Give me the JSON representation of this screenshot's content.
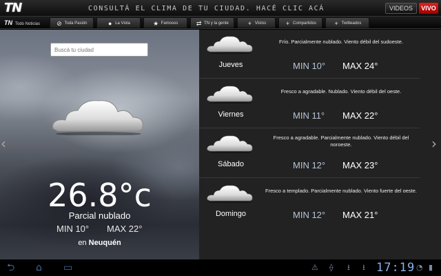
{
  "header": {
    "logo": "TN",
    "promo": "CONSULTÁ EL CLIMA DE TU CIUDAD. HACÉ CLIC ACÁ",
    "videos_label": "VIDEOS",
    "vivo_label": "VIVO"
  },
  "nav": {
    "logo": "TN",
    "home_label": "Todo Noticias",
    "items": [
      {
        "label": "Toda Pasión",
        "icon": "ball-icon"
      },
      {
        "label": "La Viola",
        "icon": "guitar-icon"
      },
      {
        "label": "Famosos",
        "icon": "star-icon"
      },
      {
        "label": "TN y la gente",
        "icon": "people-icon"
      },
      {
        "label": "Vistos",
        "icon": "plus-icon"
      },
      {
        "label": "Compartidos",
        "icon": "plus-icon"
      },
      {
        "label": "Twitteados",
        "icon": "plus-icon"
      }
    ]
  },
  "current": {
    "search_placeholder": "Buscá tu ciudad",
    "temperature": "26.8°c",
    "condition": "Parcial nublado",
    "min": "MIN 10°",
    "max": "MAX 22°",
    "location_prefix": "en",
    "location": "Neuquén",
    "icon": "cloud-icon"
  },
  "forecast": [
    {
      "day": "Jueves",
      "description": "Frío. Parcialmente nublado. Viento débil del sudoeste.",
      "min": "MIN 10°",
      "max": "MAX 24°",
      "icon": "cloud-icon"
    },
    {
      "day": "Viernes",
      "description": "Fresco a agradable. Nublado. Viento débil del oeste.",
      "min": "MIN 11°",
      "max": "MAX 22°",
      "icon": "cloud-icon"
    },
    {
      "day": "Sábado",
      "description": "Fresco a agradable. Parcialmente nublado. Viento débil del noroeste.",
      "min": "MIN 12°",
      "max": "MAX 23°",
      "icon": "cloud-icon"
    },
    {
      "day": "Domingo",
      "description": "Fresco a templado. Parcialmente nublado. Viento fuerte del oeste.",
      "min": "MIN 12°",
      "max": "MAX 21°",
      "icon": "cloud-icon"
    }
  ],
  "system": {
    "clock": "17:19",
    "status_icons": [
      "warning-icon",
      "usb-icon",
      "download-icon",
      "download-icon",
      "wifi-icon",
      "battery-icon"
    ]
  },
  "colors": {
    "accent": "#e01818",
    "system_blue": "#8ab4e8"
  }
}
